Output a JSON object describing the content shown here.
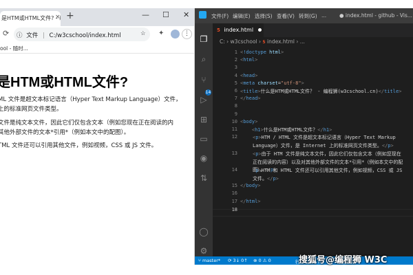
{
  "browser": {
    "tab_title": "是HTM或HTML文件? - 编",
    "tab_close": "×",
    "new_tab": "+",
    "window_controls": {
      "minimize": "—",
      "maximize": "☐",
      "close": "✕"
    },
    "reload_icon": "⟳",
    "info_icon": "ⓘ",
    "url_label": "文件",
    "url": "C:/w3cschool/index.html",
    "star_icon": "☆",
    "extension_icon": "✦",
    "menu_icon": "⋮",
    "bookmarks": "ool - 随时...",
    "page": {
      "heading": "是HTM或HTML文件?",
      "paragraphs": [
        "ML 文件是超文本标记语言（Hyper Text Markup Language）文件，\n上的标准网页文件类型。",
        "文件是纯文本文件，因此它们仅包含文本（例如您现在正在阅读的内\n其他外部文件的文本*引用*（例如本文中的配图）。",
        "TML 文件还可以引用其他文件，例如视频，CSS 或 JS 文件。"
      ]
    }
  },
  "vscode": {
    "menus": [
      "文件(F)",
      "编辑(E)",
      "选择(S)",
      "查看(V)",
      "转到(G)",
      "..."
    ],
    "window_title": "● index.html - github - Vis...",
    "activity": [
      "files-icon",
      "search-icon",
      "source-control-icon",
      "run-icon",
      "extensions-icon",
      "remote-icon",
      "github-icon",
      "pull-request-icon",
      "account-icon",
      "settings-icon"
    ],
    "scm_badge": "14",
    "tab": {
      "badge": "5",
      "name": "index.html"
    },
    "breadcrumb": {
      "part1": "C:",
      "part2": "w3cschool",
      "part3": "index.html",
      "part4": "..."
    },
    "lines": [
      {
        "n": "1",
        "html": "<span class='gray'>&lt;</span><span class='t'>!doctype</span> <span class='a'>html</span><span class='gray'>&gt;</span>"
      },
      {
        "n": "2",
        "html": "<span class='gray'>&lt;</span><span class='t'>html</span><span class='gray'>&gt;</span>"
      },
      {
        "n": "3",
        "html": ""
      },
      {
        "n": "4",
        "html": "<span class='gray'>&lt;</span><span class='t'>head</span><span class='gray'>&gt;</span>"
      },
      {
        "n": "5",
        "html": "<span class='gray'>&lt;</span><span class='t'>meta</span> <span class='a'>charset</span><span class='x'>=</span><span class='s'>\"utf-8\"</span><span class='gray'>&gt;</span>"
      },
      {
        "n": "6",
        "html": "<span class='gray'>&lt;</span><span class='t'>title</span><span class='gray'>&gt;</span><span class='x'>什么是HTM或HTML文件？ - 编程狮(w3cschool.cn)</span><span class='gray'>&lt;/</span><span class='t'>title</span><span class='gray'>&gt;</span>"
      },
      {
        "n": "7",
        "html": "<span class='gray'>&lt;/</span><span class='t'>head</span><span class='gray'>&gt;</span>"
      },
      {
        "n": "8",
        "html": ""
      },
      {
        "n": "9",
        "html": ""
      },
      {
        "n": "10",
        "html": "<span class='gray'>&lt;</span><span class='t'>body</span><span class='gray'>&gt;</span>"
      },
      {
        "n": "11",
        "html": "    <span class='gray'>&lt;</span><span class='t'>h1</span><span class='gray'>&gt;</span><span class='x'>什么是HTM或HTML文件？</span><span class='gray'>&lt;/</span><span class='t'>h1</span><span class='gray'>&gt;</span>"
      },
      {
        "n": "12",
        "html": "<span class='gray'>&lt;</span><span class='t'>p</span><span class='gray'>&gt;</span><span class='x'>HTM / HTML 文件是超文本标记语言（Hyper Text Markup Language）文件，是 Internet 上的标准网页文件类型。</span><span class='gray'>&lt;/</span><span class='t'>p</span><span class='gray'>&gt;</span>",
        "wrap": true
      },
      {
        "n": "13",
        "html": "<span class='gray'>&lt;</span><span class='t'>p</span><span class='gray'>&gt;</span><span class='x'>由于 HTM 文件是纯文本文件，因此它们仅包含文本（例如您现在正在阅读的内容）以及对其他外部文件的文本*引用*（例如本文中的配图）。</span><span class='gray'>&lt;/</span><span class='t'>p</span><span class='gray'>&gt;</span>",
        "wrap": true
      },
      {
        "n": "14",
        "html": "<span class='gray'>&lt;</span><span class='t'>p</span><span class='gray'>&gt;</span><span class='x'>HTM 和 HTML 文件还可以引用其他文件，例如视频，CSS 或 JS 文件。</span><span class='gray'>&lt;/</span><span class='t'>p</span><span class='gray'>&gt;</span>",
        "wrap": true
      },
      {
        "n": "15",
        "html": "<span class='gray'>&lt;/</span><span class='t'>body</span><span class='gray'>&gt;</span>"
      },
      {
        "n": "16",
        "html": ""
      },
      {
        "n": "17",
        "html": "<span class='gray'>&lt;/</span><span class='t'>html</span><span class='gray'>&gt;</span>"
      },
      {
        "n": "18",
        "html": ""
      }
    ],
    "status": {
      "branch": "master*",
      "sync": "⟳ 3↓ 0↑",
      "problems": "⊗ 0 ⚠ 0",
      "position": "行 18，列 1",
      "spaces": "空格: 4"
    }
  },
  "watermark": "搜狐号@编程狮 W3C"
}
